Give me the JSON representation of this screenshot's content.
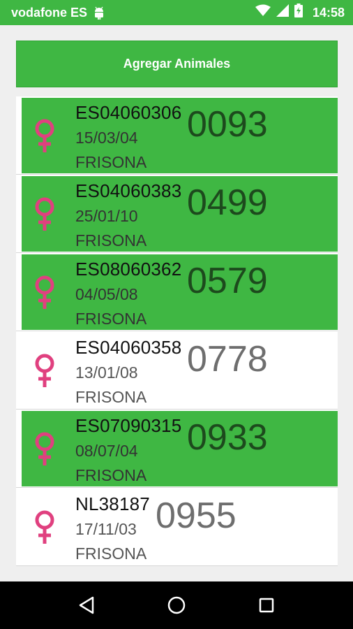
{
  "status_bar": {
    "carrier": "vodafone ES",
    "time": "14:58"
  },
  "add_button": {
    "label": "Agregar Animales"
  },
  "colors": {
    "green": "#3fb743",
    "female_icon": "#e0407f"
  },
  "animals": [
    {
      "code": "ES04060306",
      "date": "15/03/04",
      "breed": "FRISONA",
      "number": "0093",
      "sex_icon": "female-icon",
      "highlighted": true
    },
    {
      "code": "ES04060383",
      "date": "25/01/10",
      "breed": "FRISONA",
      "number": "0499",
      "sex_icon": "female-icon",
      "highlighted": true
    },
    {
      "code": "ES08060362",
      "date": "04/05/08",
      "breed": "FRISONA",
      "number": "0579",
      "sex_icon": "female-icon",
      "highlighted": true
    },
    {
      "code": "ES04060358",
      "date": "13/01/08",
      "breed": "FRISONA",
      "number": "0778",
      "sex_icon": "female-icon",
      "highlighted": false
    },
    {
      "code": "ES07090315",
      "date": "08/07/04",
      "breed": "FRISONA",
      "number": "0933",
      "sex_icon": "female-icon",
      "highlighted": true
    },
    {
      "code": "NL38187",
      "date": "17/11/03",
      "breed": "FRISONA",
      "number": "0955",
      "sex_icon": "female-icon",
      "highlighted": false
    }
  ]
}
